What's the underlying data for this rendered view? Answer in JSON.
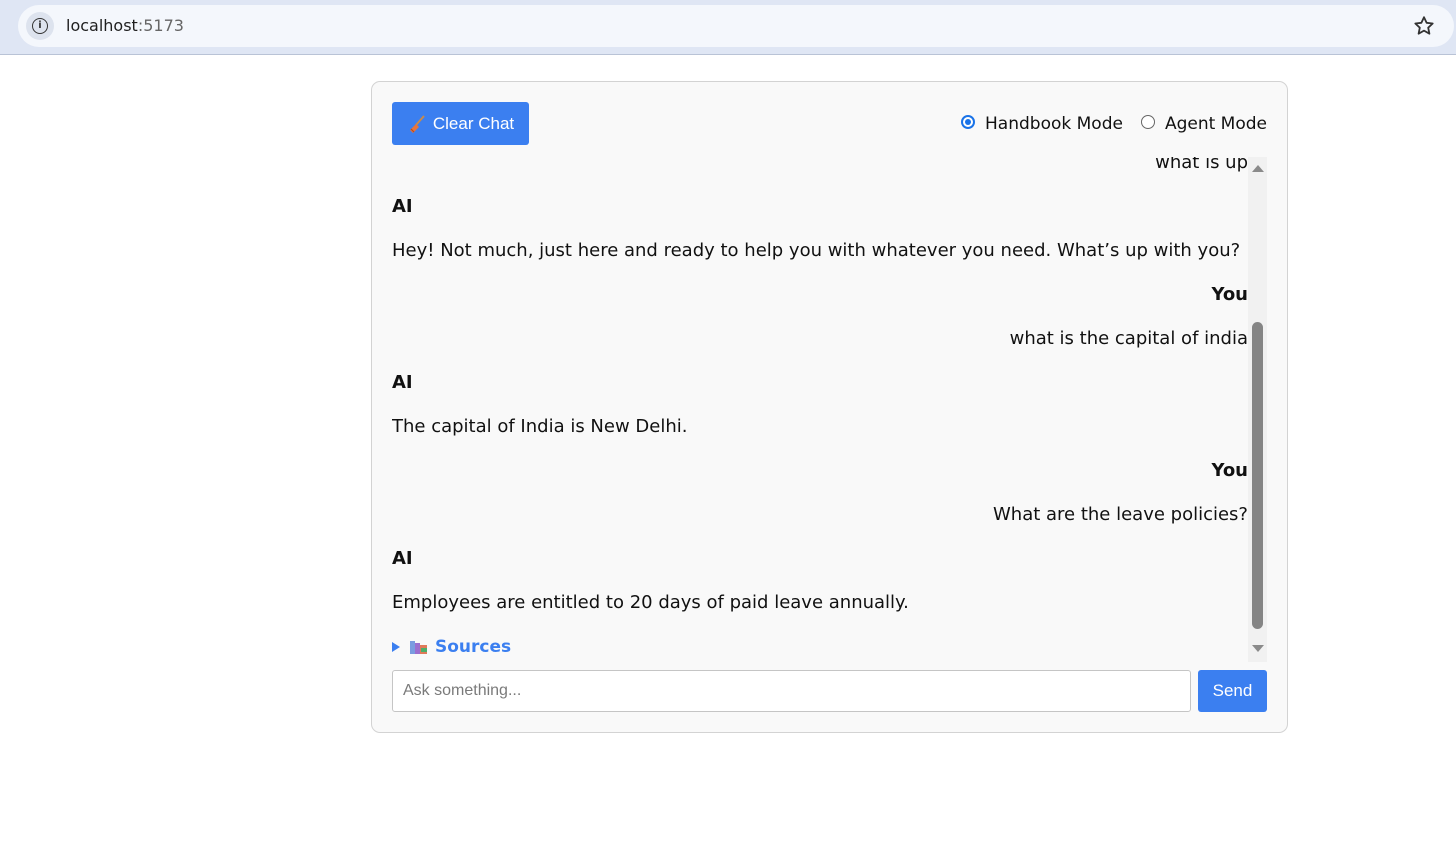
{
  "browser": {
    "url_host": "localhost",
    "url_port": ":5173",
    "icons": [
      "site-info-icon",
      "bookmark-star-icon"
    ]
  },
  "toolbar": {
    "clear_label": "Clear Chat",
    "clear_icon": "broom-icon",
    "modes": [
      {
        "label": "Handbook Mode",
        "selected": true
      },
      {
        "label": "Agent Mode",
        "selected": false
      }
    ]
  },
  "messages": [
    {
      "role": "user",
      "text": "what is up"
    },
    {
      "role": "ai",
      "sender": "AI",
      "text": "Hey! Not much, just here and ready to help you with whatever you need. What’s up with you?"
    },
    {
      "role": "user",
      "sender": "You",
      "text": "what is the capital of india"
    },
    {
      "role": "ai",
      "sender": "AI",
      "text": "The capital of India is New Delhi."
    },
    {
      "role": "user",
      "sender": "You",
      "text": "What are the leave policies?"
    },
    {
      "role": "ai",
      "sender": "AI",
      "text": "Employees are entitled to 20 days of paid leave annually."
    }
  ],
  "sources": {
    "label": "Sources",
    "icon": "books-icon",
    "expanded": false
  },
  "composer": {
    "placeholder": "Ask something...",
    "value": "",
    "send_label": "Send"
  },
  "colors": {
    "accent": "#3b7ff0",
    "radio_selected": "#1a73e8",
    "card_background": "#f9f9f9"
  }
}
